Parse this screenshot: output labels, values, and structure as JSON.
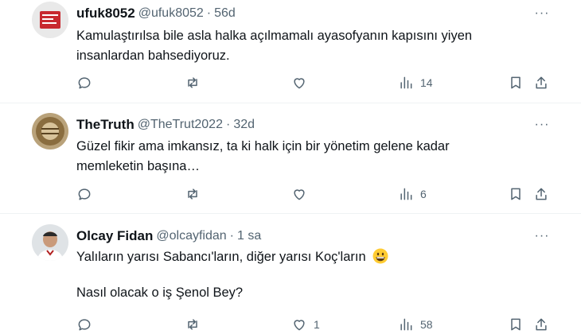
{
  "tweets": [
    {
      "name": "ufuk8052",
      "handle": "@ufuk8052",
      "dot": "·",
      "time": "56d",
      "lines": [
        "Kamulaştırılsa bile asla halka açılmamalı ayasofyanın kapısını yiyen",
        "insanlardan bahsediyoruz."
      ],
      "views": "14",
      "likes": ""
    },
    {
      "name": "TheTruth",
      "handle": "@TheTrut2022",
      "dot": "·",
      "time": "32d",
      "lines": [
        "Güzel fikir ama imkansız, ta ki halk için bir yönetim gelene kadar",
        "memleketin başına…"
      ],
      "views": "6",
      "likes": ""
    },
    {
      "name": "Olcay Fidan",
      "handle": "@olcayfidan",
      "dot": "·",
      "time": "1 sa",
      "lines": [
        "Yalıların yarısı Sabancı'ların, diğer yarısı Koç'ların",
        "Nasıl olacak o iş Şenol Bey?"
      ],
      "emoji": "grinning-face",
      "views": "58",
      "likes": "1"
    }
  ],
  "more_label": "···",
  "colors": {
    "text": "#0f1419",
    "muted": "#536471",
    "divider": "#eff3f4"
  }
}
